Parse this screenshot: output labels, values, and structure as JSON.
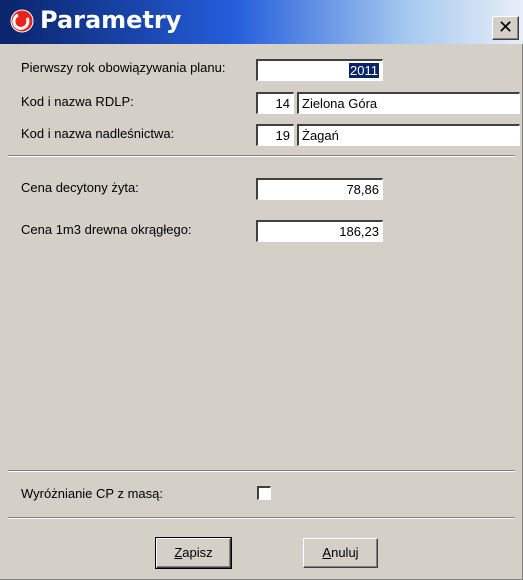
{
  "window": {
    "title": "Parametry",
    "close_label": "✕"
  },
  "form": {
    "first_year_label": "Pierwszy rok obowiązywania planu:",
    "first_year_value": "2011",
    "rdlp_label": "Kod i nazwa RDLP:",
    "rdlp_code": "14",
    "rdlp_name": "Zielona Góra",
    "forestry_label": "Kod i nazwa nadleśnictwa:",
    "forestry_code": "19",
    "forestry_name": "Żagań",
    "rye_price_label": "Cena decytony żyta:",
    "rye_price_value": "78,86",
    "wood_price_label": "Cena 1m3 drewna okrągłego:",
    "wood_price_value": "186,23",
    "highlight_label": "Wyróżnianie CP z masą:",
    "highlight_checked": false
  },
  "buttons": {
    "save_mnemonic": "Z",
    "save_rest": "apisz",
    "cancel_mnemonic": "A",
    "cancel_rest": "nuluj"
  },
  "colors": {
    "titlebar_start": "#0a246a",
    "titlebar_end": "#e8eef8",
    "face": "#d4d0c8",
    "selection": "#0a246a",
    "icon_red": "#e8241c"
  },
  "icons": {
    "app": "red-circle-logo-icon",
    "close": "close-x-icon"
  }
}
